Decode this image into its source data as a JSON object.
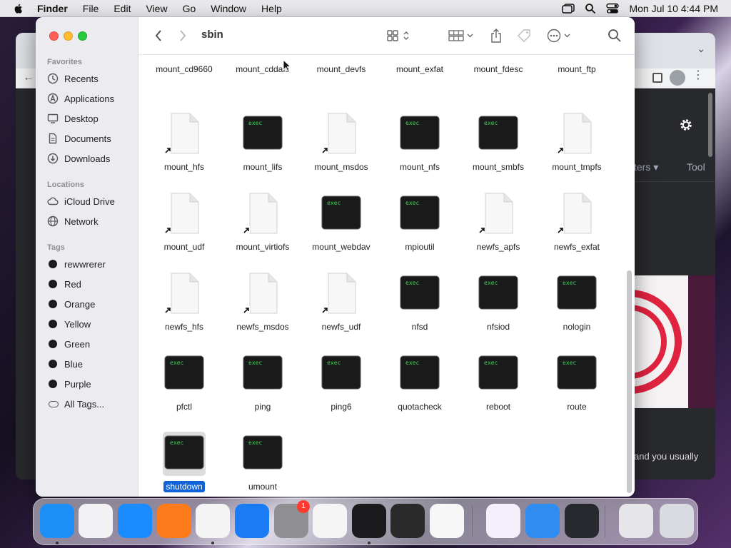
{
  "menubar": {
    "items": [
      "Finder",
      "File",
      "Edit",
      "View",
      "Go",
      "Window",
      "Help"
    ],
    "clock": "Mon Jul 10  4:44 PM"
  },
  "finder": {
    "title": "sbin",
    "sidebar": {
      "favorites_heading": "Favorites",
      "favorites": [
        "Recents",
        "Applications",
        "Desktop",
        "Documents",
        "Downloads"
      ],
      "locations_heading": "Locations",
      "locations": [
        "iCloud Drive",
        "Network"
      ],
      "tags_heading": "Tags",
      "tags": [
        {
          "name": "rewwrerer",
          "color": "#1c1c1e"
        },
        {
          "name": "Red",
          "color": "#1c1c1e"
        },
        {
          "name": "Orange",
          "color": "#1c1c1e"
        },
        {
          "name": "Yellow",
          "color": "#1c1c1e"
        },
        {
          "name": "Green",
          "color": "#1c1c1e"
        },
        {
          "name": "Blue",
          "color": "#1c1c1e"
        },
        {
          "name": "Purple",
          "color": "#1c1c1e"
        },
        {
          "name": "All Tags...",
          "color": ""
        }
      ]
    },
    "files": [
      {
        "name": "mount_cd9660",
        "kind": "partial"
      },
      {
        "name": "mount_cddafs",
        "kind": "partial"
      },
      {
        "name": "mount_devfs",
        "kind": "partial"
      },
      {
        "name": "mount_exfat",
        "kind": "partial"
      },
      {
        "name": "mount_fdesc",
        "kind": "partial"
      },
      {
        "name": "mount_ftp",
        "kind": "partial"
      },
      {
        "name": "mount_hfs",
        "kind": "alias"
      },
      {
        "name": "mount_lifs",
        "kind": "exec"
      },
      {
        "name": "mount_msdos",
        "kind": "alias"
      },
      {
        "name": "mount_nfs",
        "kind": "exec"
      },
      {
        "name": "mount_smbfs",
        "kind": "exec"
      },
      {
        "name": "mount_tmpfs",
        "kind": "alias"
      },
      {
        "name": "mount_udf",
        "kind": "alias"
      },
      {
        "name": "mount_virtiofs",
        "kind": "alias"
      },
      {
        "name": "mount_webdav",
        "kind": "exec"
      },
      {
        "name": "mpioutil",
        "kind": "exec"
      },
      {
        "name": "newfs_apfs",
        "kind": "alias"
      },
      {
        "name": "newfs_exfat",
        "kind": "alias"
      },
      {
        "name": "newfs_hfs",
        "kind": "alias"
      },
      {
        "name": "newfs_msdos",
        "kind": "alias"
      },
      {
        "name": "newfs_udf",
        "kind": "alias"
      },
      {
        "name": "nfsd",
        "kind": "exec"
      },
      {
        "name": "nfsiod",
        "kind": "exec"
      },
      {
        "name": "nologin",
        "kind": "exec"
      },
      {
        "name": "pfctl",
        "kind": "exec"
      },
      {
        "name": "ping",
        "kind": "exec"
      },
      {
        "name": "ping6",
        "kind": "exec"
      },
      {
        "name": "quotacheck",
        "kind": "exec"
      },
      {
        "name": "reboot",
        "kind": "exec"
      },
      {
        "name": "route",
        "kind": "exec"
      },
      {
        "name": "shutdown",
        "kind": "exec",
        "selected": true
      },
      {
        "name": "umount",
        "kind": "exec"
      }
    ],
    "exec_label": "exec"
  },
  "background_browser": {
    "filters_text": "ters",
    "tool_text": "Tool",
    "snippet_text": "and you usually"
  },
  "dock": {
    "apps": [
      {
        "name": "finder",
        "color": "#1e8ff7",
        "running": true
      },
      {
        "name": "launchpad",
        "color": "#f2f2f5"
      },
      {
        "name": "safari",
        "color": "#1a8cff"
      },
      {
        "name": "firefox",
        "color": "#ff7a1a"
      },
      {
        "name": "chrome",
        "color": "#f4f4f4",
        "running": true
      },
      {
        "name": "app-store",
        "color": "#1a7cf5"
      },
      {
        "name": "system-settings",
        "color": "#8e8e93",
        "badge": "1"
      },
      {
        "name": "textedit",
        "color": "#f5f5f5"
      },
      {
        "name": "terminal",
        "color": "#1b1b1d",
        "running": true
      },
      {
        "name": "garageband",
        "color": "#2a2a2a"
      },
      {
        "name": "vscode",
        "color": "#f7f7f7"
      },
      {
        "name": "visual-studio",
        "color": "#f4f0fb"
      },
      {
        "name": "weather",
        "color": "#2f8cf0"
      },
      {
        "name": "activity-monitor",
        "color": "#262a2e"
      },
      {
        "name": "screenshot-window",
        "color": "#e6e6ea"
      },
      {
        "name": "trash",
        "color": "#d9dbe0"
      }
    ]
  }
}
